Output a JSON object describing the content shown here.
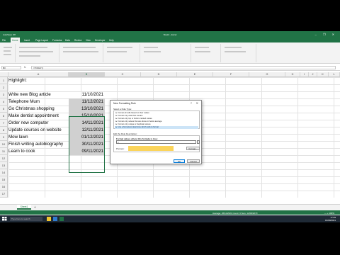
{
  "app": {
    "title": "Book1 - Excel",
    "quick_access": "AutoSave  Off",
    "window_controls": "–  ❐  ✕",
    "user": "Kate Peters"
  },
  "menus": [
    "File",
    "Home",
    "Insert",
    "Page Layout",
    "Formulas",
    "Data",
    "Review",
    "View",
    "Developer",
    "Help"
  ],
  "formula_bar": {
    "name_box": "B3",
    "fx": "fx",
    "value": "=TODAY()"
  },
  "columns": [
    "A",
    "B",
    "C",
    "D",
    "E",
    "F",
    "G",
    "H",
    "I",
    "J",
    "K",
    "L"
  ],
  "rows": [
    "1",
    "2",
    "3",
    "4",
    "5",
    "6",
    "7",
    "8",
    "9",
    "10",
    "11",
    "12",
    "13",
    "14",
    "15",
    "16",
    "17"
  ],
  "sheet": {
    "a1": "Highlight:",
    "tasks": [
      "Write new Blog article",
      "Telephone Mum",
      "Go Christmas shopping",
      "Make dentist appointment",
      "Order new computer",
      "Update courses on website",
      "Mow lawn",
      "Finish writing autobiography",
      "Learn to cook"
    ],
    "dates": [
      "11/10/2021",
      "11/12/2021",
      "13/10/2021",
      "15/10/2021",
      "14/11/2021",
      "12/11/2021",
      "01/12/2021",
      "30/11/2021",
      "09/11/2021"
    ]
  },
  "sheet_tabs": {
    "active": "Sheet1",
    "add": "+"
  },
  "status": {
    "summary": "Average: 26/11/2021   Count: 9   Sum: 12/09/2270",
    "zoom": "— + 100%"
  },
  "taskbar": {
    "search_placeholder": "Type here to search",
    "time": "17:09",
    "date": "16/09/2021"
  },
  "dialog": {
    "title": "New Formatting Rule",
    "help": "?",
    "close": "✕",
    "select_rule_type_label": "Select a Rule Type:",
    "rule_types": [
      "► Format all cells based on their values",
      "► Format only cells that contain",
      "► Format only top or bottom ranked values",
      "► Format only values that are above or below average",
      "► Format only unique or duplicate values",
      "► Use a formula to determine which cells to format"
    ],
    "selected_rule_index": 5,
    "edit_rule_label": "Edit the Rule Description:",
    "formula_label": "Format values where this formula is true:",
    "formula_value": "=",
    "preview_label": "Preview:",
    "preview_color": "#fbd45a",
    "format_button": "Format...",
    "ok_button": "OK",
    "cancel_button": "Cancel"
  }
}
